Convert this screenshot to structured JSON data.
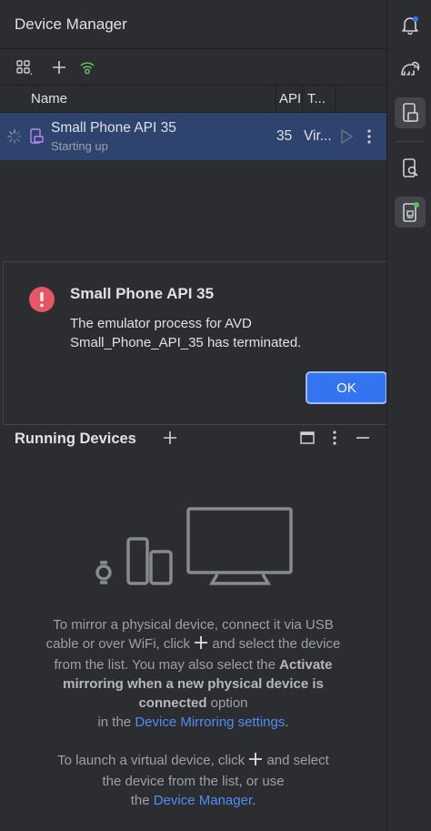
{
  "panel": {
    "title": "Device Manager",
    "columns": {
      "name": "Name",
      "api": "API",
      "type": "T..."
    },
    "device_row": {
      "name": "Small Phone API 35",
      "status": "Starting up",
      "api": "35",
      "type": "Vir..."
    }
  },
  "dialog": {
    "title": "Small Phone API 35",
    "message_line1": "The emulator process for AVD",
    "message_line2": "Small_Phone_API_35 has terminated.",
    "ok_label": "OK"
  },
  "running_devices": {
    "title": "Running Devices",
    "mirror_line1": "To mirror a physical device, connect it via USB",
    "mirror_line2a": "cable or over WiFi, click",
    "mirror_line2b": "and select the device",
    "mirror_line3a": "from the list. You may also select the",
    "mirror_line3b": "Activate",
    "mirror_line4": "mirroring when a new physical device is",
    "mirror_line5a": "connected",
    "mirror_line5b": "option",
    "mirror_line6a": "in the",
    "mirror_link": "Device Mirroring settings",
    "mirror_line6b": ".",
    "launch_line1a": "To launch a virtual device, click",
    "launch_line1b": "and select",
    "launch_line2": "the device from the list, or use",
    "launch_line3a": "the",
    "launch_link": "Device Manager",
    "launch_line3b": "."
  },
  "colors": {
    "background": "#2b2d30",
    "selection": "#2e436e",
    "accent": "#3574f0",
    "link": "#548af7",
    "error": "#e55765",
    "status_green": "#5fb865"
  },
  "icons": {
    "toolbar": [
      "group-icon",
      "add-icon",
      "wifi-pairing-icon"
    ],
    "rail": [
      "notifications-icon",
      "gradle-elephant-icon",
      "device-manager-icon",
      "device-explorer-icon",
      "running-devices-icon"
    ]
  }
}
